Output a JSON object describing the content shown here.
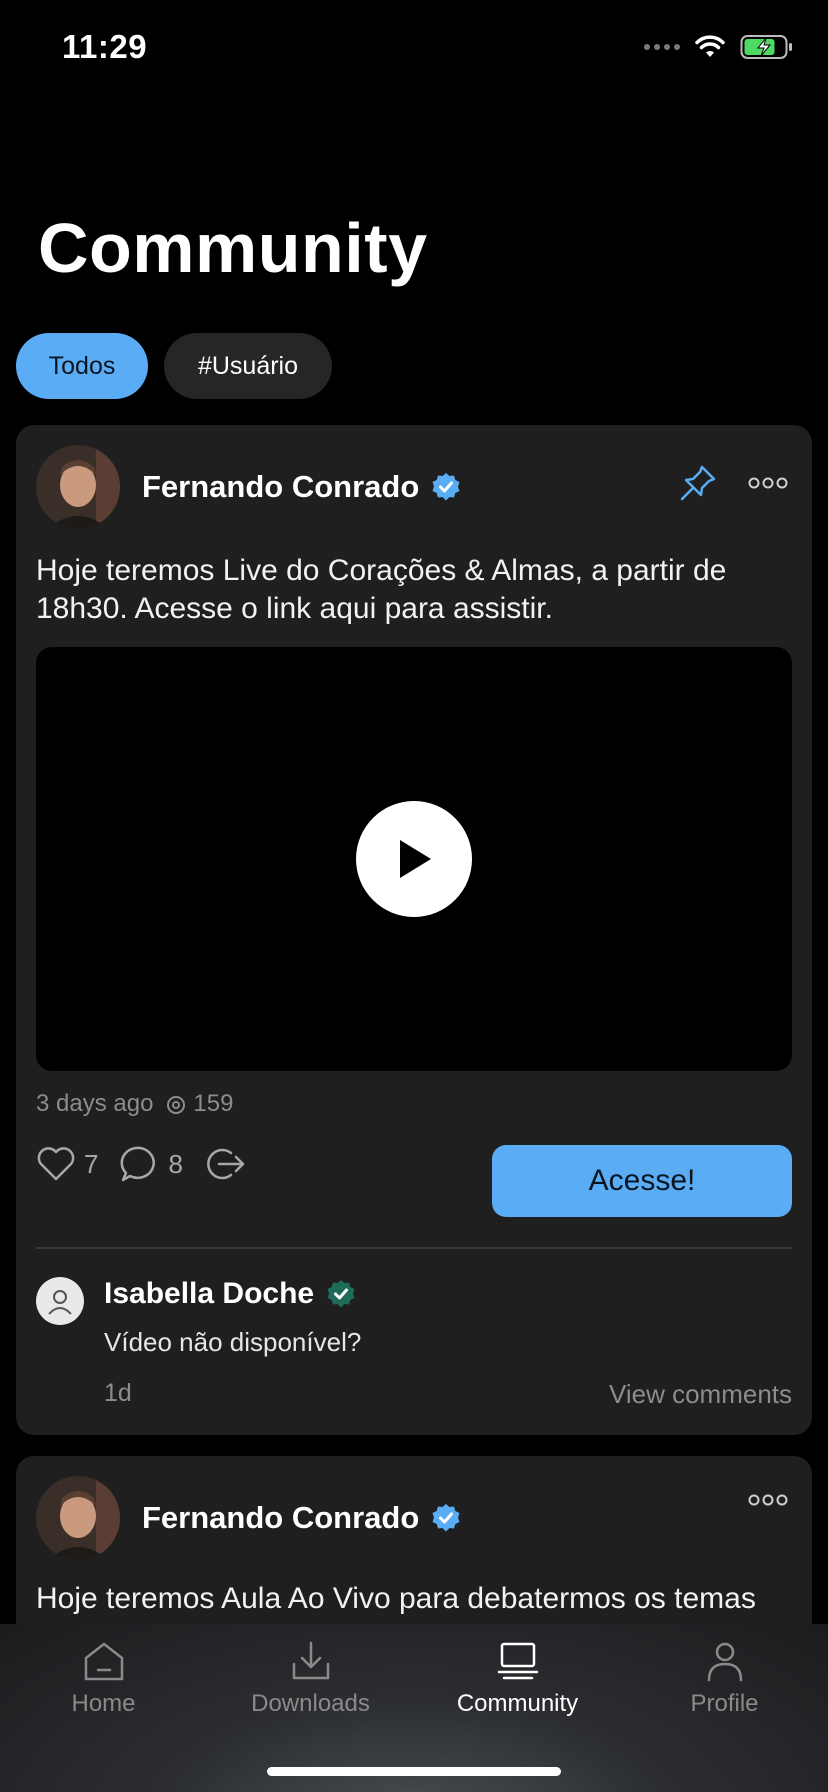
{
  "status_bar": {
    "time": "11:29"
  },
  "header": {
    "title": "Community"
  },
  "filters": [
    {
      "label": "Todos",
      "active": true
    },
    {
      "label": "#Usuário",
      "active": false
    }
  ],
  "posts": [
    {
      "author": "Fernando Conrado",
      "verified": true,
      "pinned": true,
      "text": "Hoje teremos Live do Corações & Almas, a partir de 18h30. Acesse o link aqui para assistir.",
      "time_ago": "3 days ago",
      "views": "159",
      "likes": "7",
      "comments": "8",
      "cta_label": "Acesse!",
      "latest_comment": {
        "author": "Isabella Doche",
        "text": "Vídeo não disponível?",
        "time": "1d",
        "view_comments_label": "View comments"
      }
    },
    {
      "author": "Fernando Conrado",
      "verified": true,
      "text": "Hoje teremos Aula Ao Vivo para debatermos os temas"
    }
  ],
  "tab_bar": [
    {
      "label": "Home",
      "icon": "home-icon",
      "active": false
    },
    {
      "label": "Downloads",
      "icon": "download-icon",
      "active": false
    },
    {
      "label": "Community",
      "icon": "laptop-icon",
      "active": true
    },
    {
      "label": "Profile",
      "icon": "person-icon",
      "active": false
    }
  ],
  "colors": {
    "accent": "#5aadf5",
    "background": "#000000",
    "card": "#1f1f1f",
    "muted": "#8c8c8c"
  }
}
